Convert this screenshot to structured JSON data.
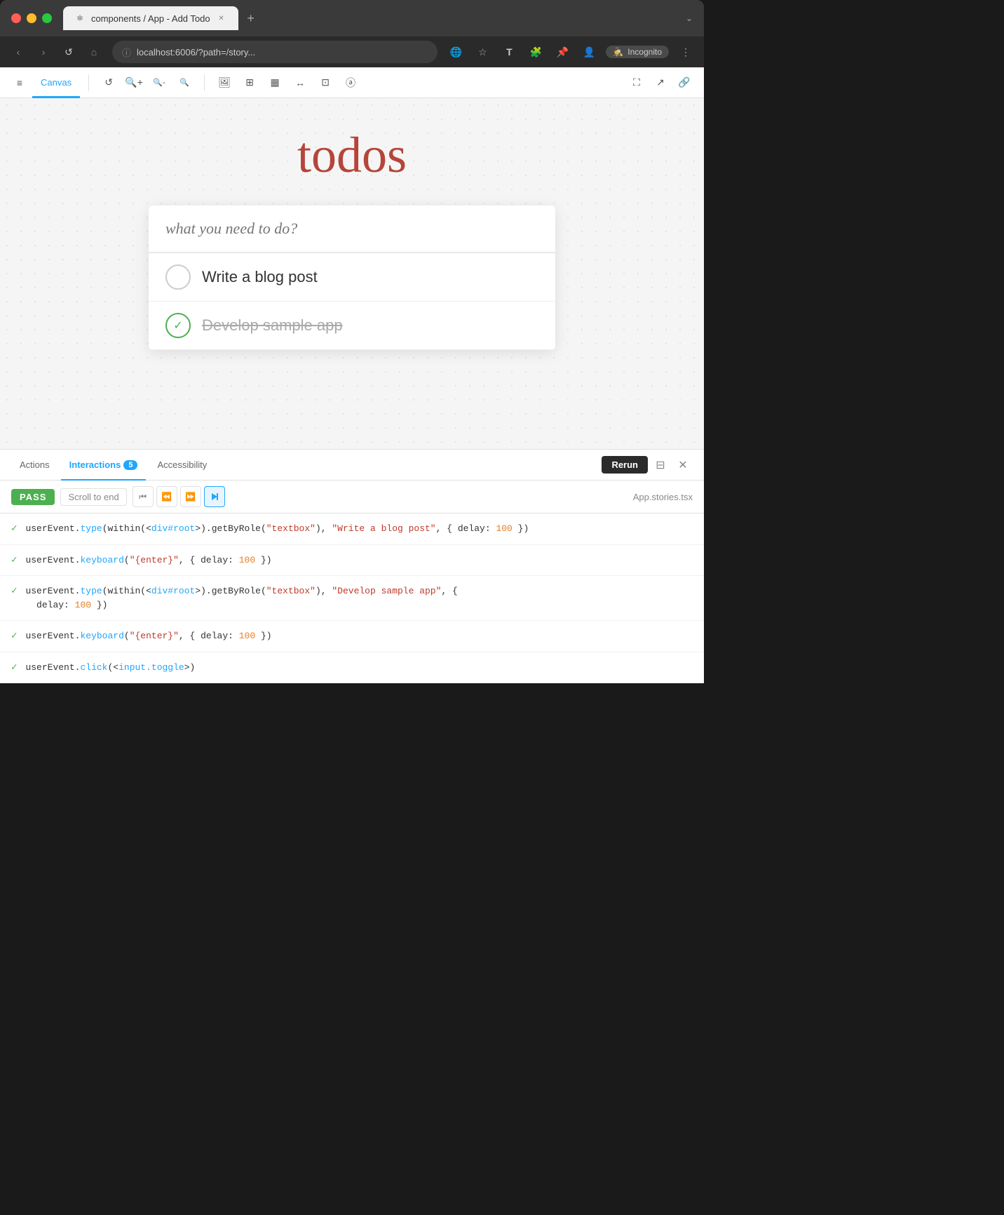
{
  "browser": {
    "tab_title": "components / App - Add Todo",
    "tab_favicon": "⚛",
    "url": "localhost:6006/?path=/story...",
    "incognito_label": "Incognito",
    "nav": {
      "back_label": "‹",
      "forward_label": "›",
      "reload_label": "↺",
      "home_label": "⌂"
    }
  },
  "storybook": {
    "active_tab": "Canvas",
    "tabs": [
      "Canvas"
    ],
    "toolbar_icons": [
      "menu",
      "reload",
      "zoom-in",
      "zoom-out",
      "zoom-reset",
      "image",
      "grid",
      "component",
      "resize",
      "crop",
      "accessibility"
    ],
    "right_toolbar_icons": [
      "fullscreen",
      "external",
      "link"
    ]
  },
  "canvas": {
    "title": "todos",
    "input_placeholder": "what you need to do?",
    "todos": [
      {
        "text": "Write a blog post",
        "completed": false
      },
      {
        "text": "Develop sample app",
        "completed": true
      }
    ]
  },
  "panel": {
    "tabs": [
      {
        "label": "Actions",
        "active": false
      },
      {
        "label": "Interactions",
        "badge": "5",
        "active": true
      },
      {
        "label": "Accessibility",
        "active": false
      }
    ],
    "rerun_label": "Rerun",
    "pass_label": "PASS",
    "scroll_end_label": "Scroll to end",
    "file_name": "App.stories.tsx",
    "interactions": [
      {
        "code_parts": [
          {
            "text": "userEvent",
            "type": "method"
          },
          {
            "text": ".",
            "type": "punctuation"
          },
          {
            "text": "type",
            "type": "keyword"
          },
          {
            "text": "(within(<",
            "type": "method"
          },
          {
            "text": "div#root",
            "type": "keyword"
          },
          {
            "text": ">).getByRole(",
            "type": "method"
          },
          {
            "text": "\"textbox\"",
            "type": "string"
          },
          {
            "text": "), ",
            "type": "method"
          },
          {
            "text": "\"Write a blog post\"",
            "type": "string"
          },
          {
            "text": ", { delay: ",
            "type": "method"
          },
          {
            "text": "100",
            "type": "number"
          },
          {
            "text": " })",
            "type": "method"
          }
        ]
      },
      {
        "code_parts": [
          {
            "text": "userEvent",
            "type": "method"
          },
          {
            "text": ".",
            "type": "punctuation"
          },
          {
            "text": "keyboard",
            "type": "keyword"
          },
          {
            "text": "(",
            "type": "method"
          },
          {
            "text": "\"{enter}\"",
            "type": "string"
          },
          {
            "text": ", { delay: ",
            "type": "method"
          },
          {
            "text": "100",
            "type": "number"
          },
          {
            "text": " })",
            "type": "method"
          }
        ]
      },
      {
        "code_parts": [
          {
            "text": "userEvent",
            "type": "method"
          },
          {
            "text": ".",
            "type": "punctuation"
          },
          {
            "text": "type",
            "type": "keyword"
          },
          {
            "text": "(within(<",
            "type": "method"
          },
          {
            "text": "div#root",
            "type": "keyword"
          },
          {
            "text": ">).getByRole(",
            "type": "method"
          },
          {
            "text": "\"textbox\"",
            "type": "string"
          },
          {
            "text": "), ",
            "type": "method"
          },
          {
            "text": "\"Develop sample app\"",
            "type": "string"
          },
          {
            "text": ", {",
            "type": "method"
          }
        ],
        "line2_parts": [
          {
            "text": "delay: ",
            "type": "method"
          },
          {
            "text": "100",
            "type": "number"
          },
          {
            "text": " })",
            "type": "method"
          }
        ]
      },
      {
        "code_parts": [
          {
            "text": "userEvent",
            "type": "method"
          },
          {
            "text": ".",
            "type": "punctuation"
          },
          {
            "text": "keyboard",
            "type": "keyword"
          },
          {
            "text": "(",
            "type": "method"
          },
          {
            "text": "\"{enter}\"",
            "type": "string"
          },
          {
            "text": ", { delay: ",
            "type": "method"
          },
          {
            "text": "100",
            "type": "number"
          },
          {
            "text": " })",
            "type": "method"
          }
        ]
      },
      {
        "code_parts": [
          {
            "text": "userEvent",
            "type": "method"
          },
          {
            "text": ".",
            "type": "punctuation"
          },
          {
            "text": "click",
            "type": "keyword"
          },
          {
            "text": "(<",
            "type": "method"
          },
          {
            "text": "input.toggle",
            "type": "keyword"
          },
          {
            "text": ">)",
            "type": "method"
          }
        ]
      }
    ]
  }
}
